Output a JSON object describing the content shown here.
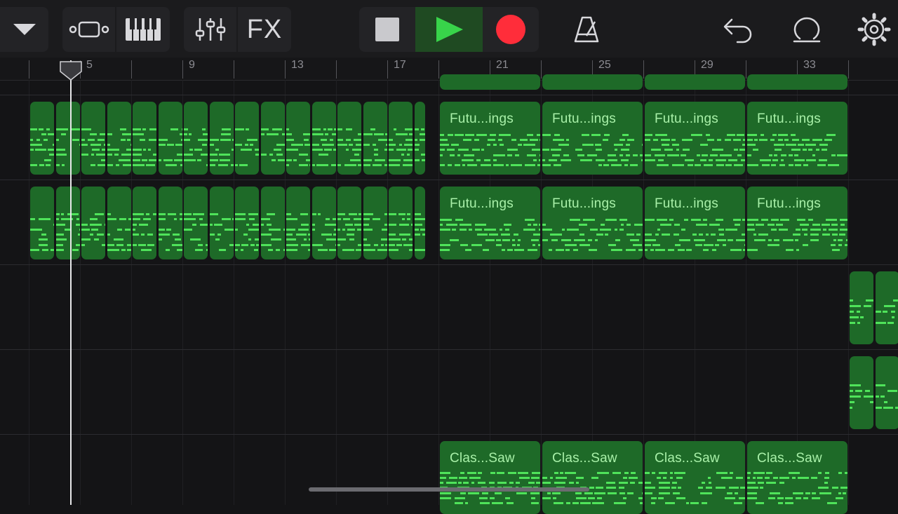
{
  "toolbar": {
    "buttons": [
      {
        "name": "tracks-menu",
        "icon": "triangle-down-icon"
      },
      {
        "name": "tracks-view",
        "icon": "tracks-view-icon"
      },
      {
        "name": "keyboard",
        "icon": "piano-keys-icon"
      },
      {
        "name": "mixer",
        "icon": "sliders-icon"
      },
      {
        "name": "fx",
        "label": "FX"
      },
      {
        "name": "stop",
        "icon": "stop-icon"
      },
      {
        "name": "play",
        "icon": "play-icon"
      },
      {
        "name": "record",
        "icon": "record-icon"
      },
      {
        "name": "metronome",
        "icon": "metronome-icon"
      },
      {
        "name": "undo",
        "icon": "undo-icon"
      },
      {
        "name": "loop-browser",
        "icon": "loop-icon"
      },
      {
        "name": "settings",
        "icon": "gear-icon"
      }
    ],
    "fx_label": "FX"
  },
  "ruler": {
    "bar_numbers": [
      "5",
      "9",
      "13",
      "17",
      "21",
      "25",
      "29",
      "33"
    ]
  },
  "regions": {
    "lane2": [
      "Futu...ings",
      "Futu...ings",
      "Futu...ings",
      "Futu...ings"
    ],
    "lane3": [
      "Futu...ings",
      "Futu...ings",
      "Futu...ings",
      "Futu...ings"
    ],
    "lane6": [
      "Clas...Saw",
      "Clas...Saw",
      "Clas...Saw",
      "Clas...Saw"
    ]
  },
  "colors": {
    "region_fill": "#1e6a28",
    "note": "#4fe35a",
    "play_active_bg": "#1f4a22",
    "play_icon": "#38d44a",
    "record": "#ff2d3a"
  }
}
